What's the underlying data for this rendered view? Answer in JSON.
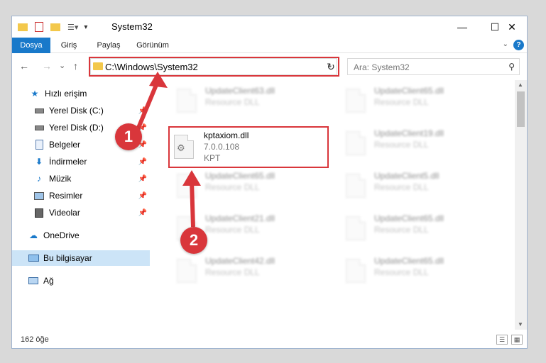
{
  "window": {
    "title": "System32",
    "controls": {
      "minimize": "—",
      "maximize": "☐",
      "close": "✕"
    }
  },
  "ribbon": {
    "tabs": [
      "Dosya",
      "Giriş",
      "Paylaş",
      "Görünüm"
    ],
    "help": "?"
  },
  "nav": {
    "back": "←",
    "forward": "→",
    "recent": "⌄",
    "up": "↑",
    "address": "C:\\Windows\\System32",
    "refresh": "↻",
    "search_placeholder": "Ara: System32"
  },
  "sidebar": {
    "items": [
      {
        "label": "Hızlı erişim",
        "icon": "star-icon"
      },
      {
        "label": "Yerel Disk (C:)",
        "icon": "drive-icon"
      },
      {
        "label": "Yerel Disk (D:)",
        "icon": "drive-icon"
      },
      {
        "label": "Belgeler",
        "icon": "documents-icon"
      },
      {
        "label": "İndirmeler",
        "icon": "download-icon"
      },
      {
        "label": "Müzik",
        "icon": "music-icon"
      },
      {
        "label": "Resimler",
        "icon": "pictures-icon"
      },
      {
        "label": "Videolar",
        "icon": "videos-icon"
      },
      {
        "label": "OneDrive",
        "icon": "cloud-icon"
      },
      {
        "label": "Bu bilgisayar",
        "icon": "computer-icon"
      },
      {
        "label": "Ağ",
        "icon": "network-icon"
      }
    ]
  },
  "files": {
    "left": [
      {
        "name": "UpdateClient63.dll",
        "type": "Resource DLL"
      },
      {
        "name": "UpdateClient65.dll",
        "type": "Resource DLL"
      },
      {
        "name": "UpdateClient21.dll",
        "type": "Resource DLL"
      },
      {
        "name": "UpdateClient42.dll",
        "type": "Resource DLL"
      }
    ],
    "right": [
      {
        "name": "UpdateClient65.dll",
        "type": "Resource DLL"
      },
      {
        "name": "UpdateClient19.dll",
        "type": "Resource DLL"
      },
      {
        "name": "UpdateClient5.dll",
        "type": "Resource DLL"
      },
      {
        "name": "UpdateClient65.dll",
        "type": "Resource DLL"
      },
      {
        "name": "UpdateClient65.dll",
        "type": "Resource DLL"
      }
    ],
    "highlighted": {
      "name": "kptaxiom.dll",
      "version": "7.0.0.108",
      "company": "KPT"
    }
  },
  "status": {
    "count": "162 öğe"
  },
  "badges": {
    "one": "1",
    "two": "2"
  },
  "colors": {
    "accent": "#1979ca",
    "highlight": "#d9363b",
    "selected": "#cce4f7"
  }
}
